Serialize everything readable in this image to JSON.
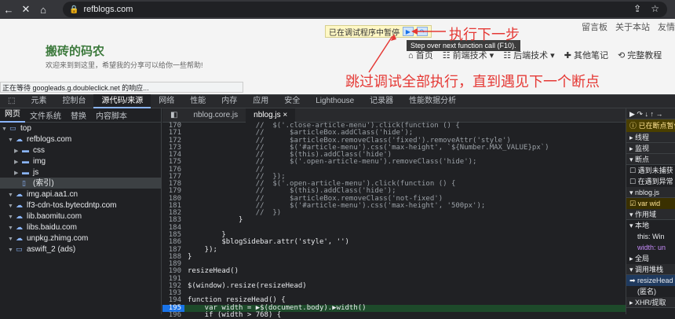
{
  "browser": {
    "url": "refblogs.com",
    "nav_back": "←",
    "nav_stop": "✕",
    "nav_home": "⌂"
  },
  "page": {
    "topnav": [
      "留言板",
      "关于本站",
      "友情"
    ],
    "site_title": "搬砖的码农",
    "site_subtitle": "欢迎来到到这里，希望我的分享可以给你一些帮助!",
    "nav_items": [
      "首页",
      "前端技术",
      "后端技术",
      "其他笔记",
      "完整教程"
    ],
    "pause_banner": "已在调试程序中暂停",
    "tooltip": "Step over next function call (F10).",
    "waiting": "正在等待 googleads.g.doubleclick.net 的响应..."
  },
  "annotations": {
    "step": "执行下一步",
    "resume": "跳过调试全部执行，直到遇见下一个断点"
  },
  "devtools": {
    "tabs": [
      "元素",
      "控制台",
      "源代码/来源",
      "网络",
      "性能",
      "内存",
      "应用",
      "安全",
      "Lighthouse",
      "记录器",
      "性能数据分析"
    ],
    "active_tab": "源代码/来源"
  },
  "navigator": {
    "tabs": [
      "网页",
      "文件系统",
      "替换",
      "内容脚本"
    ],
    "tree": [
      {
        "label": "top",
        "depth": 0,
        "type": "frame"
      },
      {
        "label": "refblogs.com",
        "depth": 1,
        "type": "cloud"
      },
      {
        "label": "css",
        "depth": 2,
        "type": "folder"
      },
      {
        "label": "img",
        "depth": 2,
        "type": "folder"
      },
      {
        "label": "js",
        "depth": 2,
        "type": "folder"
      },
      {
        "label": "(索引)",
        "depth": 2,
        "type": "file"
      },
      {
        "label": "img.api.aa1.cn",
        "depth": 1,
        "type": "cloud"
      },
      {
        "label": "lf3-cdn-tos.bytecdntp.com",
        "depth": 1,
        "type": "cloud"
      },
      {
        "label": "lib.baomitu.com",
        "depth": 1,
        "type": "cloud"
      },
      {
        "label": "libs.baidu.com",
        "depth": 1,
        "type": "cloud"
      },
      {
        "label": "unpkg.zhimg.com",
        "depth": 1,
        "type": "cloud"
      },
      {
        "label": "aswift_2 (ads)",
        "depth": 1,
        "type": "frame"
      }
    ]
  },
  "editor": {
    "tabs": [
      "nblog.core.js",
      "nblog.js"
    ],
    "active_tab": "nblog.js",
    "lines": [
      {
        "n": "170",
        "code": "                //  $('.close-article-menu').click(function () {"
      },
      {
        "n": "171",
        "code": "                //      $articleBox.addClass('hide');"
      },
      {
        "n": "172",
        "code": "                //      $articleBox.removeClass('fixed').removeAttr('style')"
      },
      {
        "n": "173",
        "code": "                //      $('#article-menu').css('max-height', `${Number.MAX_VALUE}px`)"
      },
      {
        "n": "174",
        "code": "                //      $(this).addClass('hide')"
      },
      {
        "n": "175",
        "code": "                //      $('.open-article-menu').removeClass('hide');"
      },
      {
        "n": "176",
        "code": "                //"
      },
      {
        "n": "177",
        "code": "                //  });"
      },
      {
        "n": "178",
        "code": "                //  $('.open-article-menu').click(function () {"
      },
      {
        "n": "179",
        "code": "                //      $(this).addClass('hide');"
      },
      {
        "n": "180",
        "code": "                //      $articleBox.removeClass('not-fixed')"
      },
      {
        "n": "181",
        "code": "                //      $('#article-menu').css('max-height', '500px');"
      },
      {
        "n": "182",
        "code": "                //  })"
      },
      {
        "n": "183",
        "code": "            }"
      },
      {
        "n": "184",
        "code": ""
      },
      {
        "n": "185",
        "code": "        }"
      },
      {
        "n": "186",
        "code": "        $blogSidebar.attr('style', '')"
      },
      {
        "n": "187",
        "code": "    });"
      },
      {
        "n": "188",
        "code": "}"
      },
      {
        "n": "189",
        "code": ""
      },
      {
        "n": "190",
        "code": "resizeHead()"
      },
      {
        "n": "191",
        "code": ""
      },
      {
        "n": "192",
        "code": "$(window).resize(resizeHead)"
      },
      {
        "n": "193",
        "code": ""
      },
      {
        "n": "194",
        "code": "function resizeHead() {"
      },
      {
        "n": "195",
        "code": "    var width = ▶$(document.body).▶width()"
      },
      {
        "n": "196",
        "code": "    if (width > 768) {"
      }
    ],
    "highlight_line": "195"
  },
  "sidebar": {
    "paused_label": "已在断点暂停",
    "sections": [
      "线程",
      "监视",
      "断点"
    ],
    "checkboxes": [
      "遇到未捕获",
      "在遇到异常"
    ],
    "file": "nblog.js",
    "bp_line": "var wid",
    "scope_head": "作用域",
    "local": "本地",
    "this_label": "this: Win",
    "width_label": "width: un",
    "global": "全局",
    "callstack": "调用堆栈",
    "frame1": "resizeHead",
    "frame2": "(匿名)",
    "frame3": "XHR/提取"
  }
}
